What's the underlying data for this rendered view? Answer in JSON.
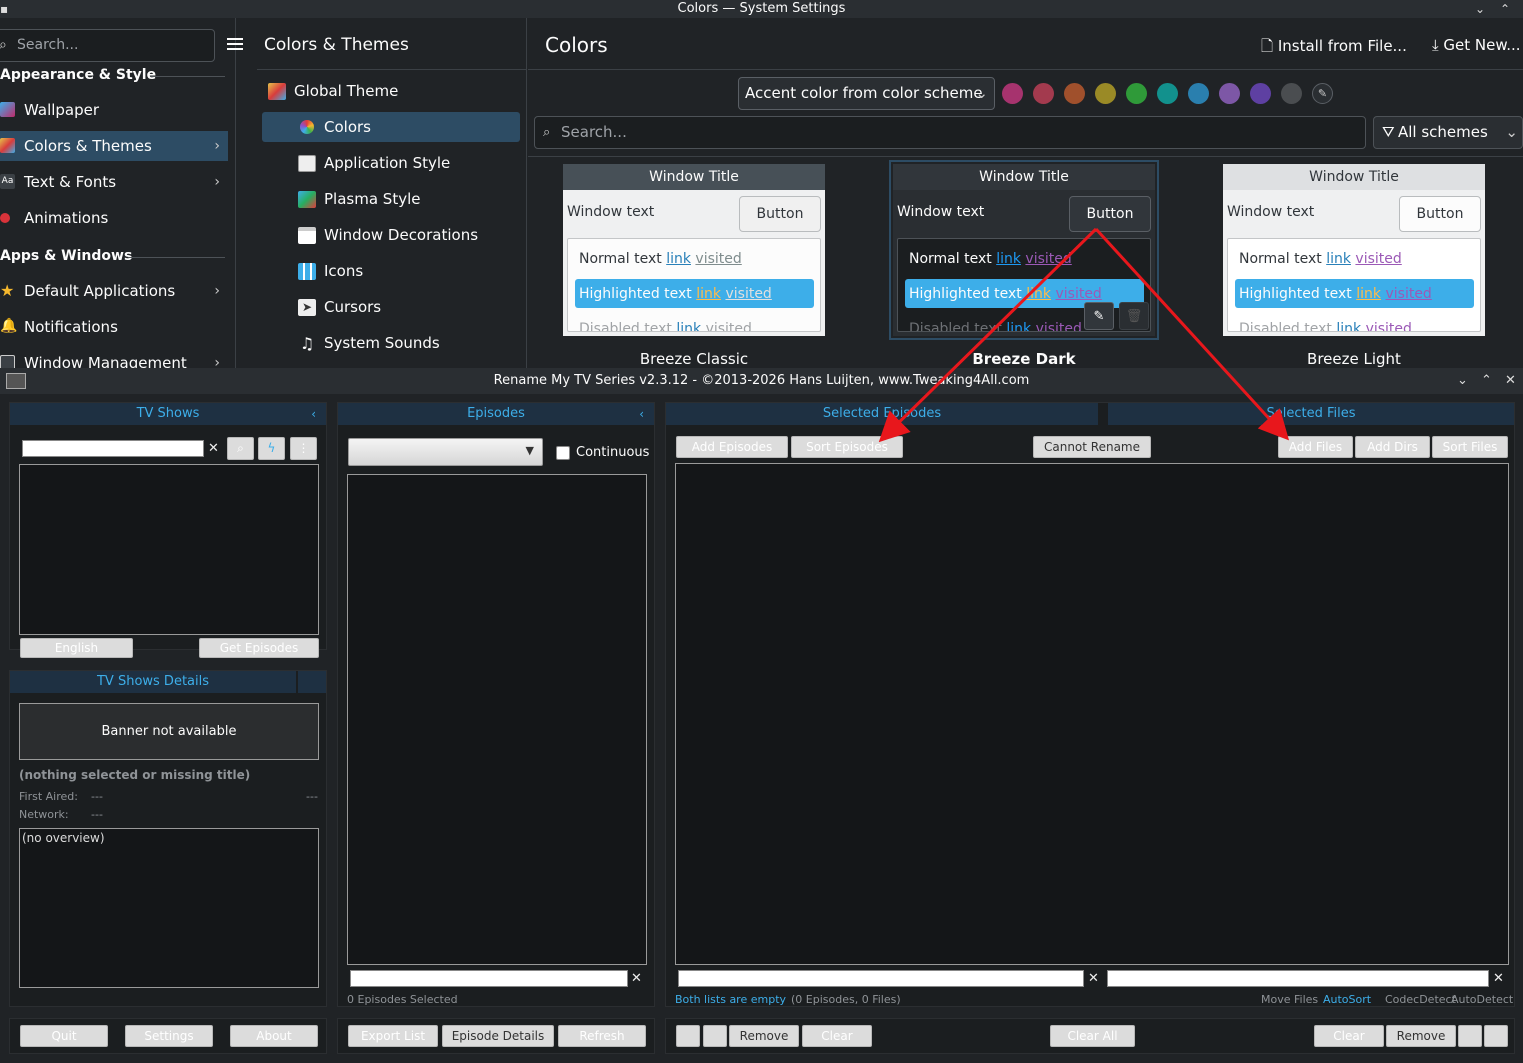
{
  "system_settings": {
    "window_title": "Colors — System Settings",
    "search_placeholder": "Search...",
    "sidebar": {
      "sections": [
        {
          "label": "Appearance & Style"
        },
        {
          "label": "Apps & Windows"
        }
      ],
      "items": [
        {
          "label": "Wallpaper",
          "icon": "wallpaper-icon"
        },
        {
          "label": "Colors & Themes",
          "icon": "colors-themes-icon",
          "selected": true
        },
        {
          "label": "Text & Fonts",
          "icon": "text-fonts-icon"
        },
        {
          "label": "Animations",
          "icon": "animations-icon"
        },
        {
          "label": "Default Applications",
          "icon": "star-icon"
        },
        {
          "label": "Notifications",
          "icon": "bell-icon"
        },
        {
          "label": "Window Management",
          "icon": "window-management-icon"
        }
      ]
    },
    "subcategory": {
      "title": "Colors & Themes",
      "items": [
        {
          "label": "Global Theme"
        },
        {
          "label": "Colors",
          "selected": true
        },
        {
          "label": "Application Style"
        },
        {
          "label": "Plasma Style"
        },
        {
          "label": "Window Decorations"
        },
        {
          "label": "Icons"
        },
        {
          "label": "Cursors"
        },
        {
          "label": "System Sounds"
        }
      ]
    },
    "main": {
      "title": "Colors",
      "install_label": "Install from File...",
      "get_new_label": "Get New...",
      "accent_select": "Accent color from color scheme",
      "accent_swatches": [
        "#a6336e",
        "#a33a4e",
        "#a0502c",
        "#9a8a26",
        "#2f9a39",
        "#12918d",
        "#2a7fae",
        "#7d57a6",
        "#5e40a2",
        "#4a4d50"
      ],
      "search_placeholder": "Search...",
      "filter_label": "All schemes",
      "previews": [
        {
          "name": "Breeze Classic",
          "window_title": "Window Title",
          "window_text": "Window text",
          "button": "Button",
          "normal": "Normal text",
          "highlighted": "Highlighted text",
          "disabled": "Disabled text",
          "link": "link",
          "visited": "visited"
        },
        {
          "name": "Breeze Dark",
          "window_title": "Window Title",
          "window_text": "Window text",
          "button": "Button",
          "normal": "Normal text",
          "highlighted": "Highlighted text",
          "disabled": "Disabled text",
          "link": "link",
          "visited": "visited"
        },
        {
          "name": "Breeze Light",
          "window_title": "Window Title",
          "window_text": "Window text",
          "button": "Button",
          "normal": "Normal text",
          "highlighted": "Highlighted text",
          "disabled": "Disabled text",
          "link": "link",
          "visited": "visited"
        }
      ]
    }
  },
  "rename_app": {
    "window_title": "Rename My TV Series v2.3.12 - ©2013-2026 Hans Luijten, www.Tweaking4All.com",
    "tv_shows": {
      "header": "TV Shows",
      "language_button": "English",
      "get_episodes_button": "Get Episodes"
    },
    "details": {
      "header": "TV Shows Details",
      "banner": "Banner not available",
      "title": "(nothing selected or missing title)",
      "first_aired_label": "First Aired:",
      "first_aired_value": "---",
      "first_aired_extra": "---",
      "network_label": "Network:",
      "network_value": "---",
      "overview": "(no overview)"
    },
    "bottom_left_buttons": [
      "Quit",
      "Settings",
      "About"
    ],
    "episodes": {
      "header": "Episodes",
      "continuous_label": "Continuous",
      "status": "0 Episodes Selected",
      "buttons": [
        "Export List",
        "Episode Details",
        "Refresh"
      ]
    },
    "selected_episodes": {
      "header": "Selected Episodes",
      "add_button": "Add Episodes",
      "sort_button": "Sort Episodes",
      "cannot_rename_button": "Cannot Rename"
    },
    "selected_files": {
      "header": "Selected Files",
      "add_files_button": "Add Files",
      "add_dirs_button": "Add Dirs",
      "sort_files_button": "Sort Files"
    },
    "status_bar": {
      "both_empty": "Both lists are empty",
      "counts": "(0 Episodes, 0 Files)",
      "move_files": "Move Files",
      "auto_sort": "AutoSort",
      "codec_detect": "CodecDetect",
      "auto_detect": "AutoDetect"
    },
    "bottom_right_buttons": {
      "remove_left": "Remove",
      "clear_left": "Clear",
      "clear_all": "Clear All",
      "clear_right": "Clear",
      "remove_right": "Remove"
    }
  }
}
